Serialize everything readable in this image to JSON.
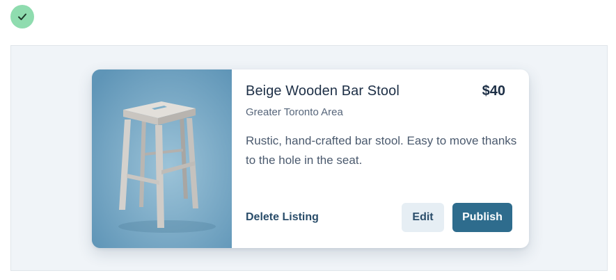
{
  "colors": {
    "status_check_bg": "#8fdcaf",
    "canvas_bg": "#f0f4f8",
    "accent": "#2e6c8d",
    "edit_bg": "#e6eef4",
    "title_text": "#1d2f46"
  },
  "status": {
    "icon": "check-icon"
  },
  "listing": {
    "image_icon": "bar-stool-image",
    "title": "Beige Wooden Bar Stool",
    "price": "$40",
    "location": "Greater Toronto Area",
    "description": "Rustic, hand-crafted bar stool. Easy to move thanks to the hole in the seat.",
    "delete_label": "Delete Listing",
    "edit_label": "Edit",
    "publish_label": "Publish"
  }
}
